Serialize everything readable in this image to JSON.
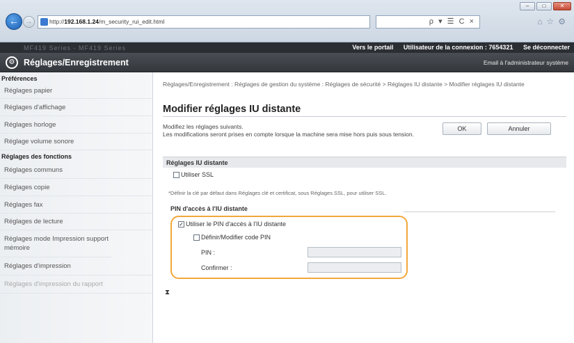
{
  "browser": {
    "url_prefix": "http://",
    "url_host": "192.168.1.24",
    "url_path": "/m_security_rui_edit.html",
    "search_controls": "ρ ▾ ☰ C ×",
    "window_controls": {
      "minimize": "–",
      "maximize": "□",
      "close": "✕"
    }
  },
  "topbar": {
    "model_text": "MF419 Series - MF419 Series",
    "portal_link": "Vers le portail",
    "user_text": "Utilisateur de la connexion : 7654321",
    "logout_link": "Se déconnecter"
  },
  "appbar": {
    "title": "Réglages/Enregistrement",
    "email_link": "Email à l'administrateur système"
  },
  "sidebar": {
    "group1": "Préférences",
    "group1_items": [
      "Réglages papier",
      "Réglages d'affichage",
      "Réglages horloge",
      "Réglage volume sonore"
    ],
    "group2": "Réglages des fonctions",
    "group2_items": [
      "Réglages communs",
      "Réglages copie",
      "Réglages fax",
      "Réglages de lecture",
      "Réglages mode Impression support mémoire",
      "Réglages d'impression",
      "Réglages d'impression du rapport"
    ]
  },
  "main": {
    "breadcrumb": "Réglages/Enregistrement : Réglages de gestion du système : Réglages de sécurité > Réglages IU distante > Modifier réglages IU distante",
    "title": "Modifier réglages IU distante",
    "desc_line1": "Modifiez les réglages suivants.",
    "desc_line2": "Les modifications seront prises en compte lorsque la machine sera mise hors puis sous tension.",
    "ok_label": "OK",
    "cancel_label": "Annuler",
    "section_title": "Réglages IU distante",
    "ssl_label": "Utiliser SSL",
    "ssl_checked": false,
    "ssl_note": "*Définir la clé par défaut dans Réglages clé et certificat, sous Réglages SSL, pour utiliser SSL.",
    "pin_section": "PIN d'accès à l'IU distante",
    "use_pin_label": "Utiliser le PIN d'accès à l'IU distante",
    "use_pin_checked": true,
    "define_pin_label": "Définir/Modifier code PIN",
    "define_pin_checked": false,
    "pin_label": "PIN :",
    "pin_value": "",
    "confirm_label": "Confirmer :",
    "confirm_value": "",
    "scroll_top_icon": "⧗"
  },
  "colors": {
    "highlight": "#f2a73b",
    "header_dark": "#2b2e33",
    "back_button": "#1b5fb4"
  }
}
